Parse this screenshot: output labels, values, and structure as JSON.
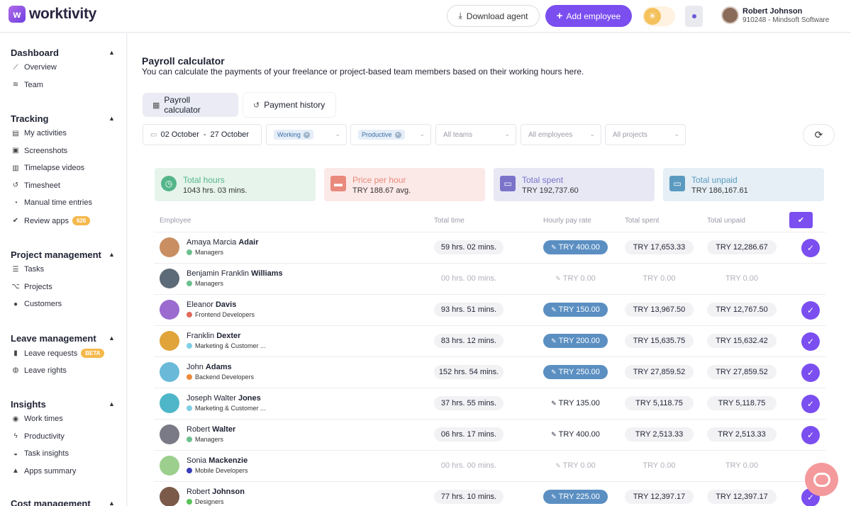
{
  "brand": {
    "name": "worktivity"
  },
  "header": {
    "download_label": "Download agent",
    "add_label": "Add employee",
    "user_name": "Robert Johnson",
    "user_org": "910248 - Mindsoft Software",
    "accent_color": "#7b4ef0"
  },
  "sidebar": {
    "sections": [
      {
        "title": "Dashboard",
        "items": [
          {
            "label": "Overview",
            "icon": "chart-icon"
          },
          {
            "label": "Team",
            "icon": "layers-icon"
          }
        ]
      },
      {
        "title": "Tracking",
        "items": [
          {
            "label": "My activities",
            "icon": "id-card-icon"
          },
          {
            "label": "Screenshots",
            "icon": "image-icon"
          },
          {
            "label": "Timelapse videos",
            "icon": "film-icon"
          },
          {
            "label": "Timesheet",
            "icon": "history-icon"
          },
          {
            "label": "Manual time entries",
            "icon": "stopwatch-icon"
          },
          {
            "label": "Review apps",
            "icon": "check-circle-icon",
            "badge": "626"
          }
        ]
      },
      {
        "title": "Project management",
        "items": [
          {
            "label": "Tasks",
            "icon": "list-icon"
          },
          {
            "label": "Projects",
            "icon": "sitemap-icon"
          },
          {
            "label": "Customers",
            "icon": "user-icon"
          }
        ]
      },
      {
        "title": "Leave management",
        "items": [
          {
            "label": "Leave requests",
            "icon": "suitcase-icon",
            "badge": "BETA"
          },
          {
            "label": "Leave rights",
            "icon": "globe-icon"
          }
        ]
      },
      {
        "title": "Insights",
        "items": [
          {
            "label": "Work times",
            "icon": "car-icon"
          },
          {
            "label": "Productivity",
            "icon": "bolt-icon"
          },
          {
            "label": "Task insights",
            "icon": "gauge-icon"
          },
          {
            "label": "Apps summary",
            "icon": "shapes-icon"
          }
        ]
      },
      {
        "title": "Cost management",
        "items": []
      }
    ]
  },
  "page": {
    "title": "Payroll calculator",
    "subtitle": "You can calculate the payments of your freelance or project-based team members based on their working hours here.",
    "tabs": [
      {
        "label": "Payroll calculator",
        "icon": "calculator-icon"
      },
      {
        "label": "Payment history",
        "icon": "history-icon"
      }
    ]
  },
  "filters": {
    "date_from": "02 October",
    "date_sep": "-",
    "date_to": "27 October",
    "status_chip": "Working",
    "productivity_chip": "Productive",
    "teams": "All teams",
    "employees": "All employees",
    "projects": "All projects"
  },
  "stats": [
    {
      "label": "Total hours",
      "value": "1043 hrs. 03 mins.",
      "bg": "#e6f4ec",
      "fg": "#55b58a",
      "icon": "clock-icon"
    },
    {
      "label": "Price per hour",
      "value": "TRY 188.67 avg.",
      "bg": "#fbe9e7",
      "fg": "#e98a7d",
      "icon": "money-icon"
    },
    {
      "label": "Total spent",
      "value": "TRY 192,737.60",
      "bg": "#e8e8f5",
      "fg": "#7a73c9",
      "icon": "wallet-icon"
    },
    {
      "label": "Total unpaid",
      "value": "TRY 186,167.61",
      "bg": "#e5eff5",
      "fg": "#5b9ac0",
      "icon": "wallet-icon"
    }
  ],
  "table": {
    "headers": {
      "employee": "Employee",
      "time": "Total time",
      "rate": "Hourly pay rate",
      "spent": "Total spent",
      "unpaid": "Total unpaid"
    },
    "rows": [
      {
        "first": "Amaya Marcia",
        "last": "Adair",
        "team": "Managers",
        "team_color": "#6cc08f",
        "time": "59 hrs. 02 mins.",
        "rate": "TRY 400.00",
        "spent": "TRY 17,653.33",
        "unpaid": "TRY 12,286.67",
        "active": true,
        "rate_style": "blue",
        "avatar": "#c98e62"
      },
      {
        "first": "Benjamin Franklin",
        "last": "Williams",
        "team": "Managers",
        "team_color": "#6cc08f",
        "time": "00 hrs. 00 mins.",
        "rate": "TRY 0.00",
        "spent": "TRY 0.00",
        "unpaid": "TRY 0.00",
        "active": false,
        "rate_style": "dim",
        "avatar": "#5d6a78"
      },
      {
        "first": "Eleanor",
        "last": "Davis",
        "team": "Frontend Developers",
        "team_color": "#e06a5a",
        "time": "93 hrs. 51 mins.",
        "rate": "TRY 150.00",
        "spent": "TRY 13,967.50",
        "unpaid": "TRY 12,767.50",
        "active": true,
        "rate_style": "blue",
        "avatar": "#9b6bd0"
      },
      {
        "first": "Franklin",
        "last": "Dexter",
        "team": "Marketing & Customer ...",
        "team_color": "#7fd0e6",
        "time": "83 hrs. 12 mins.",
        "rate": "TRY 200.00",
        "spent": "TRY 15,635.75",
        "unpaid": "TRY 15,632.42",
        "active": true,
        "rate_style": "blue",
        "avatar": "#e0a43a"
      },
      {
        "first": "John",
        "last": "Adams",
        "team": "Backend Developers",
        "team_color": "#ef8a3c",
        "time": "152 hrs. 54 mins.",
        "rate": "TRY 250.00",
        "spent": "TRY 27,859.52",
        "unpaid": "TRY 27,859.52",
        "active": true,
        "rate_style": "blue",
        "avatar": "#6ab9d8"
      },
      {
        "first": "Joseph Walter",
        "last": "Jones",
        "team": "Marketing & Customer ...",
        "team_color": "#7fd0e6",
        "time": "37 hrs. 55 mins.",
        "rate": "TRY 135.00",
        "spent": "TRY 5,118.75",
        "unpaid": "TRY 5,118.75",
        "active": true,
        "rate_style": "plain",
        "avatar": "#4fb6c9"
      },
      {
        "first": "Robert",
        "last": "Walter",
        "team": "Managers",
        "team_color": "#6cc08f",
        "time": "06 hrs. 17 mins.",
        "rate": "TRY 400.00",
        "spent": "TRY 2,513.33",
        "unpaid": "TRY 2,513.33",
        "active": true,
        "rate_style": "plain",
        "avatar": "#7a7a86"
      },
      {
        "first": "Sonia",
        "last": "Mackenzie",
        "team": "Mobile Developers",
        "team_color": "#3a3fb8",
        "time": "00 hrs. 00 mins.",
        "rate": "TRY 0.00",
        "spent": "TRY 0.00",
        "unpaid": "TRY 0.00",
        "active": false,
        "rate_style": "dim",
        "avatar": "#9ccf8e"
      },
      {
        "first": "Robert",
        "last": "Johnson",
        "team": "Designers",
        "team_color": "#58c45b",
        "time": "77 hrs. 10 mins.",
        "rate": "TRY 225.00",
        "spent": "TRY 12,397.17",
        "unpaid": "TRY 12,397.17",
        "active": true,
        "rate_style": "blue",
        "avatar": "#7b5a4a"
      }
    ]
  }
}
